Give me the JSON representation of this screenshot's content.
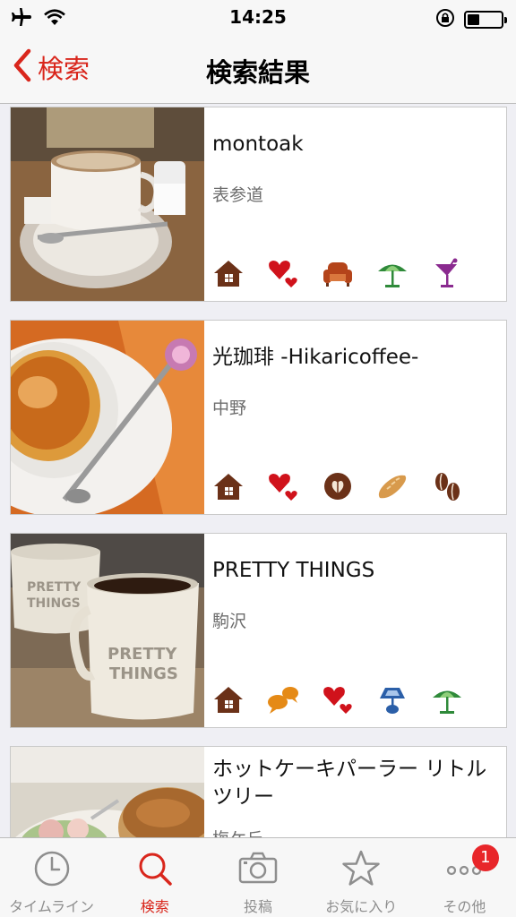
{
  "status_bar": {
    "time": "14:25",
    "battery_level": 0.35,
    "icons": [
      "airplane-icon",
      "wifi-icon",
      "rotation-lock-icon",
      "battery-icon"
    ]
  },
  "nav": {
    "back_label": "検索",
    "title": "検索結果"
  },
  "colors": {
    "accent": "#d9261c",
    "brown": "#6b3118",
    "red": "#d0121b",
    "green": "#2f8a3a",
    "purple": "#8a2a8f",
    "orange": "#e58a16",
    "blue": "#2b5fa8"
  },
  "results": [
    {
      "name": "montoak",
      "area": "表参道",
      "icons": [
        "house-icon",
        "hearts-icon",
        "sofa-icon",
        "parasol-icon",
        "cocktail-icon"
      ]
    },
    {
      "name": "光珈琲 -Hikaricoffee-",
      "area": "中野",
      "icons": [
        "house-icon",
        "hearts-icon",
        "latte-art-icon",
        "bread-icon",
        "coffee-beans-icon"
      ]
    },
    {
      "name": "PRETTY THINGS",
      "area": "駒沢",
      "icons": [
        "house-icon",
        "speech-bubbles-icon",
        "hearts-icon",
        "lamp-icon",
        "parasol-icon"
      ]
    },
    {
      "name": "ホットケーキパーラー リトルツリー",
      "area": "梅ケ丘",
      "icons": []
    }
  ],
  "tabs": [
    {
      "label": "タイムライン",
      "icon": "clock-icon"
    },
    {
      "label": "検索",
      "icon": "search-icon"
    },
    {
      "label": "投稿",
      "icon": "camera-icon"
    },
    {
      "label": "お気に入り",
      "icon": "star-icon"
    },
    {
      "label": "その他",
      "icon": "more-icon",
      "badge": "1"
    }
  ]
}
